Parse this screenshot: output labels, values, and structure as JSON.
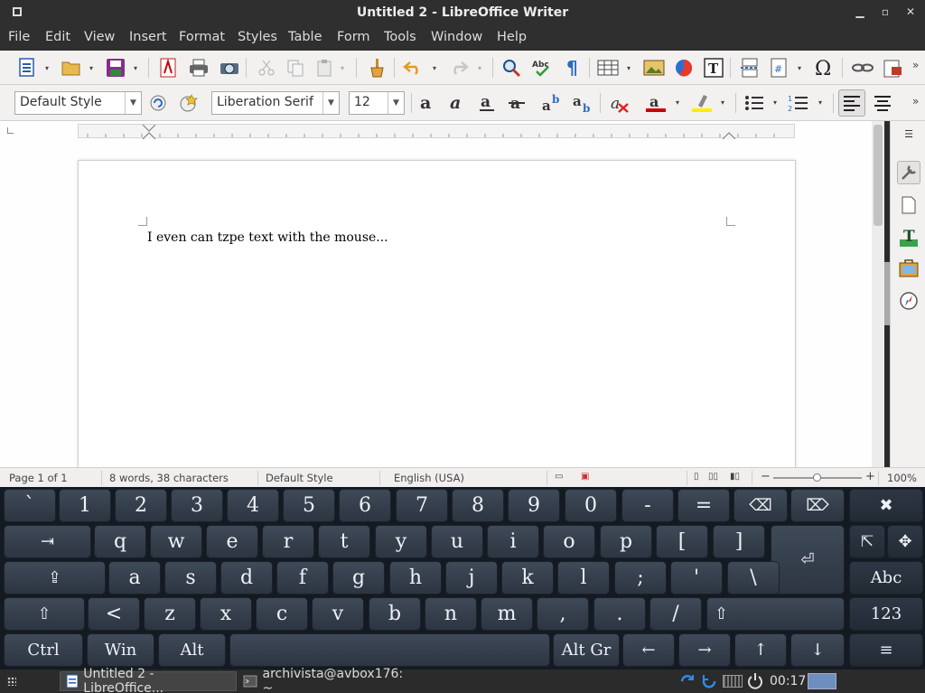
{
  "window": {
    "title": "Untitled 2 - LibreOffice Writer"
  },
  "menu": [
    "File",
    "Edit",
    "View",
    "Insert",
    "Format",
    "Styles",
    "Table",
    "Form",
    "Tools",
    "Window",
    "Help"
  ],
  "formatting": {
    "paragraph_style": "Default Style",
    "font_name": "Liberation Serif",
    "font_size": "12"
  },
  "document": {
    "text": "I even can tzpe text with the mouse..."
  },
  "status": {
    "page": "Page 1 of 1",
    "words": "8 words, 38 characters",
    "style": "Default Style",
    "language": "English (USA)",
    "zoom_minus": "−",
    "zoom_plus": "+",
    "zoom": "100%"
  },
  "keyboard": {
    "row1": [
      "`",
      "1",
      "2",
      "3",
      "4",
      "5",
      "6",
      "7",
      "8",
      "9",
      "0",
      "-",
      "=",
      "⌫",
      "⌦",
      "✖"
    ],
    "row2": [
      "⇥",
      "q",
      "w",
      "e",
      "r",
      "t",
      "y",
      "u",
      "i",
      "o",
      "p",
      "[",
      "]",
      "⏎",
      "⇱",
      "✥"
    ],
    "row3": [
      "⇪",
      "a",
      "s",
      "d",
      "f",
      "g",
      "h",
      "j",
      "k",
      "l",
      ";",
      "'",
      "\\",
      "Abc"
    ],
    "row4": [
      "⇧",
      "<",
      "z",
      "x",
      "c",
      "v",
      "b",
      "n",
      "m",
      ",",
      ".",
      "/",
      "⇧",
      "123"
    ],
    "row5": [
      "Ctrl",
      "Win",
      "Alt",
      "",
      "Alt Gr",
      "←",
      "→",
      "↑",
      "↓",
      "≡"
    ]
  },
  "taskbar": {
    "task1": "Untitled 2 - LibreOffice...",
    "task2": "archivista@avbox176: ~",
    "clock": "00:17"
  },
  "colors": {
    "font_color": "#cc0000",
    "highlight": "#ffee00"
  }
}
